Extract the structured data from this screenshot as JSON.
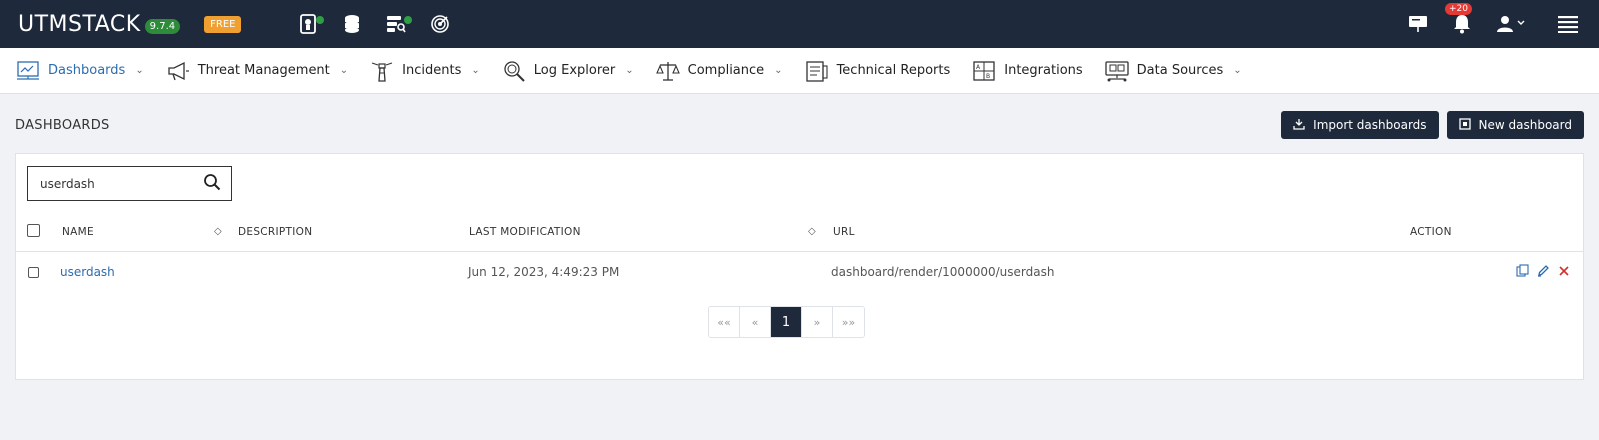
{
  "topbar": {
    "brand": "UTMSTACK",
    "version": "9.7.4",
    "plan": "FREE",
    "notification_count": "+20",
    "icons": [
      "agent-status-icon",
      "database-status-icon",
      "server-search-icon",
      "threat-radar-icon"
    ]
  },
  "nav": {
    "items": [
      {
        "label": "Dashboards",
        "icon": "dashboard-icon",
        "has_menu": true
      },
      {
        "label": "Threat Management",
        "icon": "megaphone-icon",
        "has_menu": true
      },
      {
        "label": "Incidents",
        "icon": "lighthouse-icon",
        "has_menu": true
      },
      {
        "label": "Log Explorer",
        "icon": "magnifier-icon",
        "has_menu": true
      },
      {
        "label": "Compliance",
        "icon": "scale-icon",
        "has_menu": true
      },
      {
        "label": "Technical Reports",
        "icon": "report-icon",
        "has_menu": false
      },
      {
        "label": "Integrations",
        "icon": "integrations-icon",
        "has_menu": false
      },
      {
        "label": "Data Sources",
        "icon": "data-sources-icon",
        "has_menu": true
      }
    ]
  },
  "page": {
    "title": "DASHBOARDS",
    "import_label": "Import dashboards",
    "new_label": "New dashboard"
  },
  "search": {
    "value": "userdash"
  },
  "table": {
    "headers": {
      "name": "NAME",
      "description": "DESCRIPTION",
      "last_modification": "LAST MODIFICATION",
      "url": "URL",
      "action": "ACTION"
    },
    "rows": [
      {
        "name": "userdash",
        "description": "",
        "last_modification": "Jun 12, 2023, 4:49:23 PM",
        "url": "dashboard/render/1000000/userdash"
      }
    ]
  },
  "pagination": {
    "first": "««",
    "prev": "«",
    "current": "1",
    "next": "»",
    "last": "»»"
  },
  "colors": {
    "topbar": "#1e293b",
    "accent": "#2b6cb0",
    "delete": "#d32f2f",
    "status_green": "#2ea043"
  }
}
